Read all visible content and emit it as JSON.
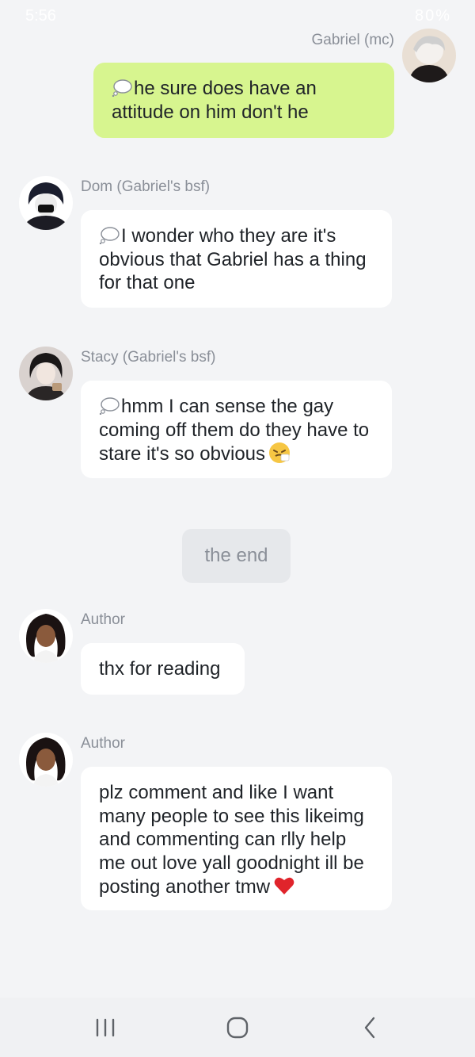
{
  "status_bar": {
    "time": "5:56",
    "battery": "80%"
  },
  "colors": {
    "background": "#f3f4f6",
    "mc_bubble": "#d7f58f",
    "other_bubble": "#ffffff",
    "name_text": "#8a8f98"
  },
  "messages": [
    {
      "sender": "Gabriel (mc)",
      "side": "right",
      "thought": true,
      "text": "he sure does have an attitude on him don't he"
    },
    {
      "sender": "Dom (Gabriel's bsf)",
      "side": "left",
      "thought": true,
      "text": "I wonder who they are it's obvious that Gabriel has a thing for that one"
    },
    {
      "sender": "Stacy (Gabriel's bsf)",
      "side": "left",
      "thought": true,
      "text": "hmm I can sense the gay coming off them do they have to stare it's so obvious",
      "emoji": "sneezing-face-icon"
    },
    {
      "narration": "the end"
    },
    {
      "sender": "Author",
      "side": "left",
      "text": "thx for reading"
    },
    {
      "sender": "Author",
      "side": "left",
      "text": "plz comment and like I want many people to see this likeimg and commenting can rlly help me out love yall goodnight ill be posting another tmw",
      "emoji": "red-heart-icon"
    }
  ],
  "nav_bar": {
    "icons": [
      "recent-apps-icon",
      "home-icon",
      "back-icon"
    ]
  }
}
